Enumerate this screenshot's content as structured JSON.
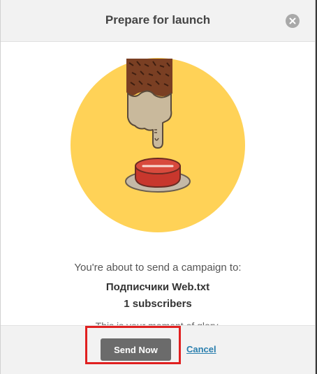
{
  "dialog": {
    "title": "Prepare for launch"
  },
  "message": {
    "intro": "You're about to send a campaign to:",
    "list_name": "Подписчики Web.txt",
    "subscribers": "1 subscribers",
    "partial_text": "This is your moment of glory."
  },
  "footer": {
    "send_label": "Send Now",
    "cancel_label": "Cancel"
  },
  "colors": {
    "circle": "#ffd257",
    "button_red": "#c8372d",
    "highlight": "#e02020",
    "link": "#2a7fae"
  },
  "icons": {
    "close": "close-icon",
    "illustration": "finger-pressing-button-illustration"
  }
}
